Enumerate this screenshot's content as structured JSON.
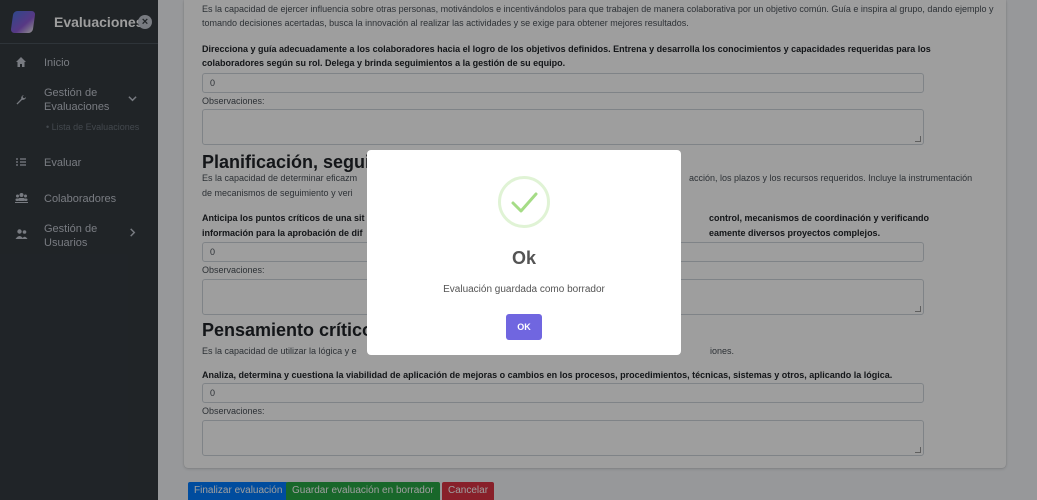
{
  "sidebar": {
    "brand": "Evaluaciones",
    "items": [
      {
        "label": "Inicio",
        "icon": "home-icon"
      },
      {
        "label": "Gestión de Evaluaciones",
        "icon": "wrench-icon"
      },
      {
        "label": "Lista de Evaluaciones",
        "icon": "dot-icon"
      },
      {
        "label": "Evaluar",
        "icon": "list-icon"
      },
      {
        "label": "Colaboradores",
        "icon": "group-icon"
      },
      {
        "label": "Gestión de Usuarios",
        "icon": "users-icon"
      }
    ]
  },
  "form": {
    "intro_text": "Es la capacidad de ejercer influencia sobre otras personas, motivándolos e incentivándolos para que trabajen de manera colaborativa por un objetivo común. Guía e inspira al grupo, dando ejemplo y tomando decisiones acertadas, busca la innovación al realizar las actividades y se exige para obtener mejores resultados.",
    "q1_text": "Direcciona y guía adecuadamente a los colaboradores hacia el logro de los objetivos definidos. Entrena y desarrolla los conocimientos y capacidades requeridas para los colaboradores según su rol. Delega y brinda seguimientos a la gestión de su equipo.",
    "q1_value": "0",
    "observaciones_label": "Observaciones:",
    "section2_title": "Planificación, seguim",
    "section2_desc_a": "Es la capacidad de determinar eficazm",
    "section2_desc_b": "acción, los plazos y los recursos requeridos. Incluye la instrumentación",
    "section2_desc_line2": "de mecanismos de seguimiento y veri",
    "q2_text_a": "Anticipa los puntos críticos de una sit",
    "q2_text_b": "control, mecanismos de coordinación y verificando",
    "q2_text_line2_a": "información para la aprobación de dif",
    "q2_text_line2_b": "eamente diversos proyectos complejos.",
    "q2_value": "0",
    "section3_title": "Pensamiento crítico p",
    "section3_desc_a": "Es la capacidad de utilizar la lógica y e",
    "section3_desc_b": "iones.",
    "q3_text": "Analiza, determina y cuestiona la viabilidad de aplicación de mejoras o cambios en los procesos, procedimientos, técnicas, sistemas y otros, aplicando la lógica.",
    "q3_value": "0"
  },
  "buttons": {
    "finalize": "Finalizar evaluación",
    "save_draft": "Guardar evaluación en borrador",
    "cancel": "Cancelar"
  },
  "modal": {
    "title": "Ok",
    "message": "Evaluación guardada como borrador",
    "ok_label": "OK"
  },
  "colors": {
    "sidebar": "#343a40",
    "primary": "#007bff",
    "success": "#28a745",
    "danger": "#dc3545",
    "modal_button": "#7066e0",
    "check": "#a5dc86"
  }
}
